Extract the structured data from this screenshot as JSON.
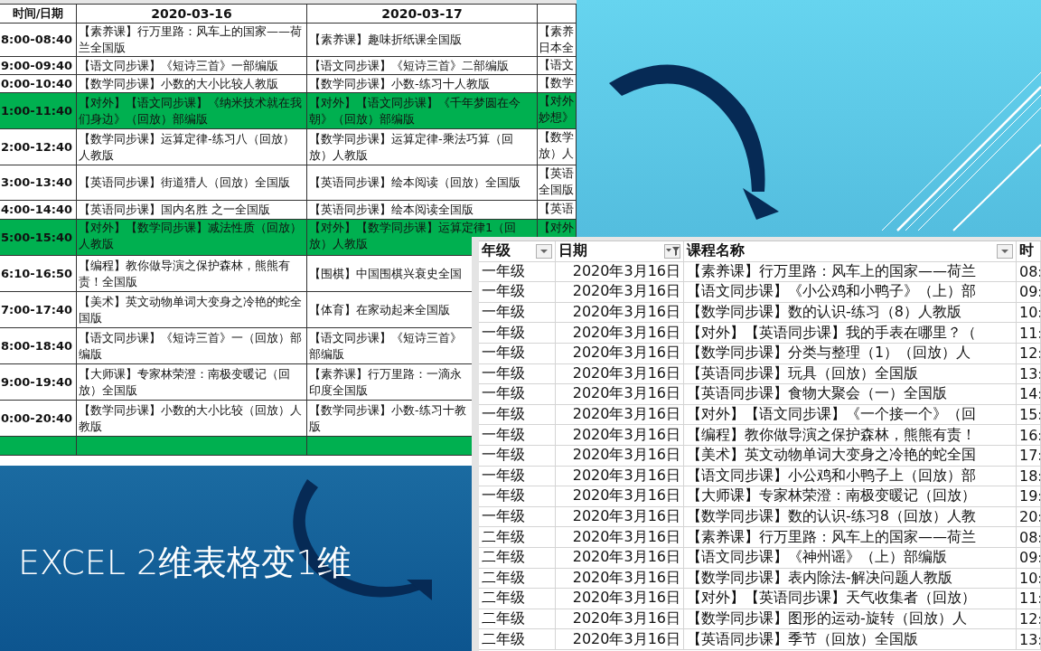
{
  "slide": {
    "title": "EXCEL 2维表格变1维"
  },
  "wide_table": {
    "columns": [
      "时间/日期",
      "2020-03-16",
      "2020-03-17"
    ],
    "rows": [
      {
        "highlighted": false,
        "cells": [
          "8:00-08:40",
          "【素养课】行万里路：风车上的国家——荷兰全国版",
          "【素养课】趣味折纸课全国版",
          "【素养日本全"
        ]
      },
      {
        "highlighted": false,
        "cells": [
          "9:00-09:40",
          "【语文同步课】《短诗三首》一部编版",
          "【语文同步课】《短诗三首》二部编版",
          "【语文"
        ]
      },
      {
        "highlighted": false,
        "cells": [
          "0:00-10:40",
          "【数学同步课】小数的大小比较人教版",
          "【数学同步课】小数-练习十人教版",
          "【数学"
        ]
      },
      {
        "highlighted": true,
        "cells": [
          "1:00-11:40",
          "【对外】【语文同步课】《纳米技术就在我们身边》（回放）部编版",
          "【对外】【语文同步课】《千年梦圆在今朝》（回放）部编版",
          "【对外妙想》"
        ]
      },
      {
        "highlighted": false,
        "cells": [
          "2:00-12:40",
          "【数学同步课】运算定律-练习八（回放）人教版",
          "【数学同步课】运算定律-乘法巧算（回放）人教版",
          "【数学放）人"
        ]
      },
      {
        "highlighted": false,
        "cells": [
          "3:00-13:40",
          "【英语同步课】街道猎人（回放）全国版",
          "【英语同步课】绘本阅读（回放）全国版",
          "【英语全国版"
        ]
      },
      {
        "highlighted": false,
        "cells": [
          "4:00-14:40",
          "【英语同步课】国内名胜 之一全国版",
          "【英语同步课】绘本阅读全国版",
          "【英语"
        ]
      },
      {
        "highlighted": true,
        "cells": [
          "5:00-15:40",
          "【对外】【数学同步课】减法性质（回放）人教版",
          "【对外】【数学同步课】运算定律1（回放）人教版",
          "【对外"
        ]
      },
      {
        "highlighted": false,
        "cells": [
          "6:10-16:50",
          "【编程】教你做导演之保护森林，熊熊有责！全国版",
          "【围棋】中国围棋兴衰史全国"
        ]
      },
      {
        "highlighted": false,
        "cells": [
          "7:00-17:40",
          "【美术】英文动物单词大变身之冷艳的蛇全国版",
          "【体育】在家动起来全国版"
        ]
      },
      {
        "highlighted": false,
        "cells": [
          "8:00-18:40",
          "【语文同步课】《短诗三首》一（回放）部编版",
          "【语文同步课】《短诗三首》部编版"
        ]
      },
      {
        "highlighted": false,
        "cells": [
          "9:00-19:40",
          "【大师课】专家林荣澄：南极变暖记（回放）全国版",
          "【素养课】行万里路：一滴永印度全国版"
        ]
      },
      {
        "highlighted": false,
        "cells": [
          "0:00-20:40",
          "【数学同步课】小数的大小比较（回放）人教版",
          "【数学同步课】小数-练习十教版"
        ]
      },
      {
        "highlighted": true,
        "cells": []
      }
    ]
  },
  "long_table": {
    "columns": [
      {
        "label": "年级",
        "kind": "dropdown"
      },
      {
        "label": "日期",
        "kind": "filtered"
      },
      {
        "label": "课程名称",
        "kind": "dropdown"
      },
      {
        "label": "时",
        "kind": "plain"
      }
    ],
    "rows": [
      [
        "一年级",
        "2020年3月16日",
        "【素养课】行万里路：风车上的国家——荷兰",
        "08:"
      ],
      [
        "一年级",
        "2020年3月16日",
        "【语文同步课】《小公鸡和小鸭子》（上）部",
        "09:"
      ],
      [
        "一年级",
        "2020年3月16日",
        "【数学同步课】数的认识-练习（8）人教版",
        "10:"
      ],
      [
        "一年级",
        "2020年3月16日",
        "【对外】【英语同步课】我的手表在哪里？（",
        "11:"
      ],
      [
        "一年级",
        "2020年3月16日",
        "【数学同步课】分类与整理（1）（回放）人",
        "12:"
      ],
      [
        "一年级",
        "2020年3月16日",
        "【英语同步课】玩具（回放）全国版",
        "13:"
      ],
      [
        "一年级",
        "2020年3月16日",
        "【英语同步课】食物大聚会（一）全国版",
        "14:"
      ],
      [
        "一年级",
        "2020年3月16日",
        "【对外】【语文同步课】《一个接一个》（回",
        "15:"
      ],
      [
        "一年级",
        "2020年3月16日",
        "【编程】教你做导演之保护森林，熊熊有责！",
        "16:"
      ],
      [
        "一年级",
        "2020年3月16日",
        "【美术】英文动物单词大变身之冷艳的蛇全国",
        "17:"
      ],
      [
        "一年级",
        "2020年3月16日",
        "【语文同步课】小公鸡和小鸭子上（回放）部",
        "18:"
      ],
      [
        "一年级",
        "2020年3月16日",
        "【大师课】专家林荣澄：南极变暖记（回放）",
        "19:"
      ],
      [
        "一年级",
        "2020年3月16日",
        "【数学同步课】数的认识-练习8（回放）人教",
        "20:"
      ],
      [
        "二年级",
        "2020年3月16日",
        "【素养课】行万里路：风车上的国家——荷兰",
        "08:"
      ],
      [
        "二年级",
        "2020年3月16日",
        "【语文同步课】《神州谣》（上）部编版",
        "09:"
      ],
      [
        "二年级",
        "2020年3月16日",
        "【数学同步课】表内除法-解决问题人教版",
        "10:"
      ],
      [
        "二年级",
        "2020年3月16日",
        "【对外】【英语同步课】天气收集者（回放）",
        "11:"
      ],
      [
        "二年级",
        "2020年3月16日",
        "【数学同步课】图形的运动-旋转（回放）人",
        "12:"
      ],
      [
        "二年级",
        "2020年3月16日",
        "【英语同步课】季节（回放）全国版",
        "13:"
      ]
    ]
  }
}
